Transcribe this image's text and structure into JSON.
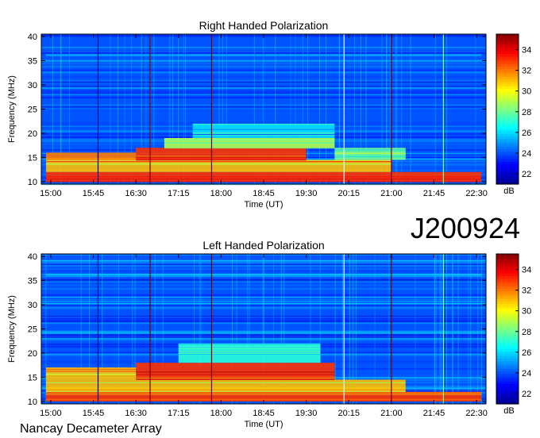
{
  "figure": {
    "id_label": "J200924",
    "footer": "Nancay Decameter Array"
  },
  "colors": {
    "scale": [
      "#00008f",
      "#0000ff",
      "#0080ff",
      "#00ffff",
      "#80ff80",
      "#ffff00",
      "#ff8000",
      "#ff0000",
      "#800000"
    ]
  },
  "chart_data": [
    {
      "type": "heatmap",
      "title": "Right Handed Polarization",
      "xlabel": "Time (UT)",
      "ylabel": "Frequency (MHz)",
      "x_ticks": [
        "15:00",
        "15:45",
        "16:30",
        "17:15",
        "18:00",
        "18:45",
        "19:30",
        "20:15",
        "21:00",
        "21:45",
        "22:30"
      ],
      "xlim": [
        "14:50",
        "22:40"
      ],
      "y_ticks": [
        10,
        15,
        20,
        25,
        30,
        35,
        40
      ],
      "ylim": [
        9.5,
        40.5
      ],
      "colorbar": {
        "unit": "dB",
        "ticks": [
          22,
          24,
          26,
          28,
          30,
          32,
          34
        ],
        "range": [
          21,
          35.5
        ]
      },
      "vertical_markers": [
        {
          "time": "15:50",
          "color": "#000080"
        },
        {
          "time": "16:45",
          "color": "#800000"
        },
        {
          "time": "17:50",
          "color": "#800000"
        },
        {
          "time": "20:10",
          "color": "#e0ffff"
        },
        {
          "time": "21:00",
          "color": "#800000"
        },
        {
          "time": "21:55",
          "color": "#80ff80"
        }
      ],
      "emission_bands": [
        {
          "f_low": 10,
          "f_high": 12,
          "start": "14:55",
          "end": "22:35",
          "level": 33
        },
        {
          "f_low": 12,
          "f_high": 14.5,
          "start": "14:55",
          "end": "21:00",
          "level": 31
        },
        {
          "f_low": 14.5,
          "f_high": 17,
          "start": "16:30",
          "end": "19:30",
          "level": 33
        },
        {
          "f_low": 14.5,
          "f_high": 16,
          "start": "14:55",
          "end": "16:30",
          "level": 32
        },
        {
          "f_low": 17,
          "f_high": 19,
          "start": "17:00",
          "end": "20:00",
          "level": 29
        },
        {
          "f_low": 19,
          "f_high": 22,
          "start": "17:30",
          "end": "20:00",
          "level": 26
        },
        {
          "f_low": 14.5,
          "f_high": 17,
          "start": "20:00",
          "end": "21:15",
          "level": 28
        },
        {
          "f_low": 36,
          "f_high": 36.4,
          "start": "14:55",
          "end": "22:35",
          "level": 26
        }
      ]
    },
    {
      "type": "heatmap",
      "title": "Left Handed Polarization",
      "xlabel": "Time (UT)",
      "ylabel": "Frequency (MHz)",
      "x_ticks": [
        "15:00",
        "15:45",
        "16:30",
        "17:15",
        "18:00",
        "18:45",
        "19:30",
        "20:15",
        "21:00",
        "21:45",
        "22:30"
      ],
      "xlim": [
        "14:50",
        "22:40"
      ],
      "y_ticks": [
        10,
        15,
        20,
        25,
        30,
        35,
        40
      ],
      "ylim": [
        9.5,
        40.5
      ],
      "colorbar": {
        "unit": "dB",
        "ticks": [
          22,
          24,
          26,
          28,
          30,
          32,
          34
        ],
        "range": [
          21,
          35.5
        ]
      },
      "vertical_markers": [
        {
          "time": "15:50",
          "color": "#000080"
        },
        {
          "time": "16:45",
          "color": "#800000"
        },
        {
          "time": "17:50",
          "color": "#800000"
        },
        {
          "time": "20:10",
          "color": "#e0ffff"
        },
        {
          "time": "21:00",
          "color": "#800000"
        },
        {
          "time": "21:55",
          "color": "#80ff80"
        }
      ],
      "emission_bands": [
        {
          "f_low": 10,
          "f_high": 12,
          "start": "14:55",
          "end": "22:35",
          "level": 33
        },
        {
          "f_low": 12,
          "f_high": 14.5,
          "start": "14:55",
          "end": "21:15",
          "level": 31
        },
        {
          "f_low": 14.5,
          "f_high": 18,
          "start": "16:30",
          "end": "20:00",
          "level": 33
        },
        {
          "f_low": 14.5,
          "f_high": 17,
          "start": "14:55",
          "end": "16:30",
          "level": 31
        },
        {
          "f_low": 18,
          "f_high": 22,
          "start": "17:15",
          "end": "19:45",
          "level": 27
        },
        {
          "f_low": 36,
          "f_high": 36.4,
          "start": "14:55",
          "end": "22:35",
          "level": 26
        }
      ]
    }
  ]
}
